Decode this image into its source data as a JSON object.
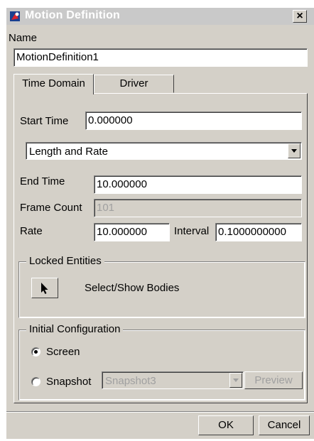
{
  "window": {
    "title": "Motion Definition",
    "close_label": "×"
  },
  "name_section": {
    "label": "Name",
    "value": "MotionDefinition1"
  },
  "tabs": [
    {
      "label": "Time Domain",
      "active": true
    },
    {
      "label": "Driver",
      "active": false
    }
  ],
  "time_domain": {
    "start_time_label": "Start Time",
    "start_time_value": "0.000000",
    "mode_selected": "Length and Rate",
    "end_time_label": "End Time",
    "end_time_value": "10.000000",
    "frame_count_label": "Frame Count",
    "frame_count_value": "101",
    "rate_label": "Rate",
    "rate_value": "10.000000",
    "interval_label": "Interval",
    "interval_value": "0.1000000000"
  },
  "locked_entities": {
    "title": "Locked Entities",
    "select_label": "Select/Show Bodies"
  },
  "initial_configuration": {
    "title": "Initial Configuration",
    "screen_label": "Screen",
    "snapshot_label": "Snapshot",
    "snapshot_selected": "Snapshot3",
    "preview_label": "Preview",
    "selected_option": "Screen"
  },
  "footer": {
    "ok_label": "OK",
    "cancel_label": "Cancel"
  },
  "colors": {
    "dialog_bg": "#d4d0c8",
    "title_bar": "#c9c9c9",
    "disabled_text": "#a0a0a0"
  }
}
